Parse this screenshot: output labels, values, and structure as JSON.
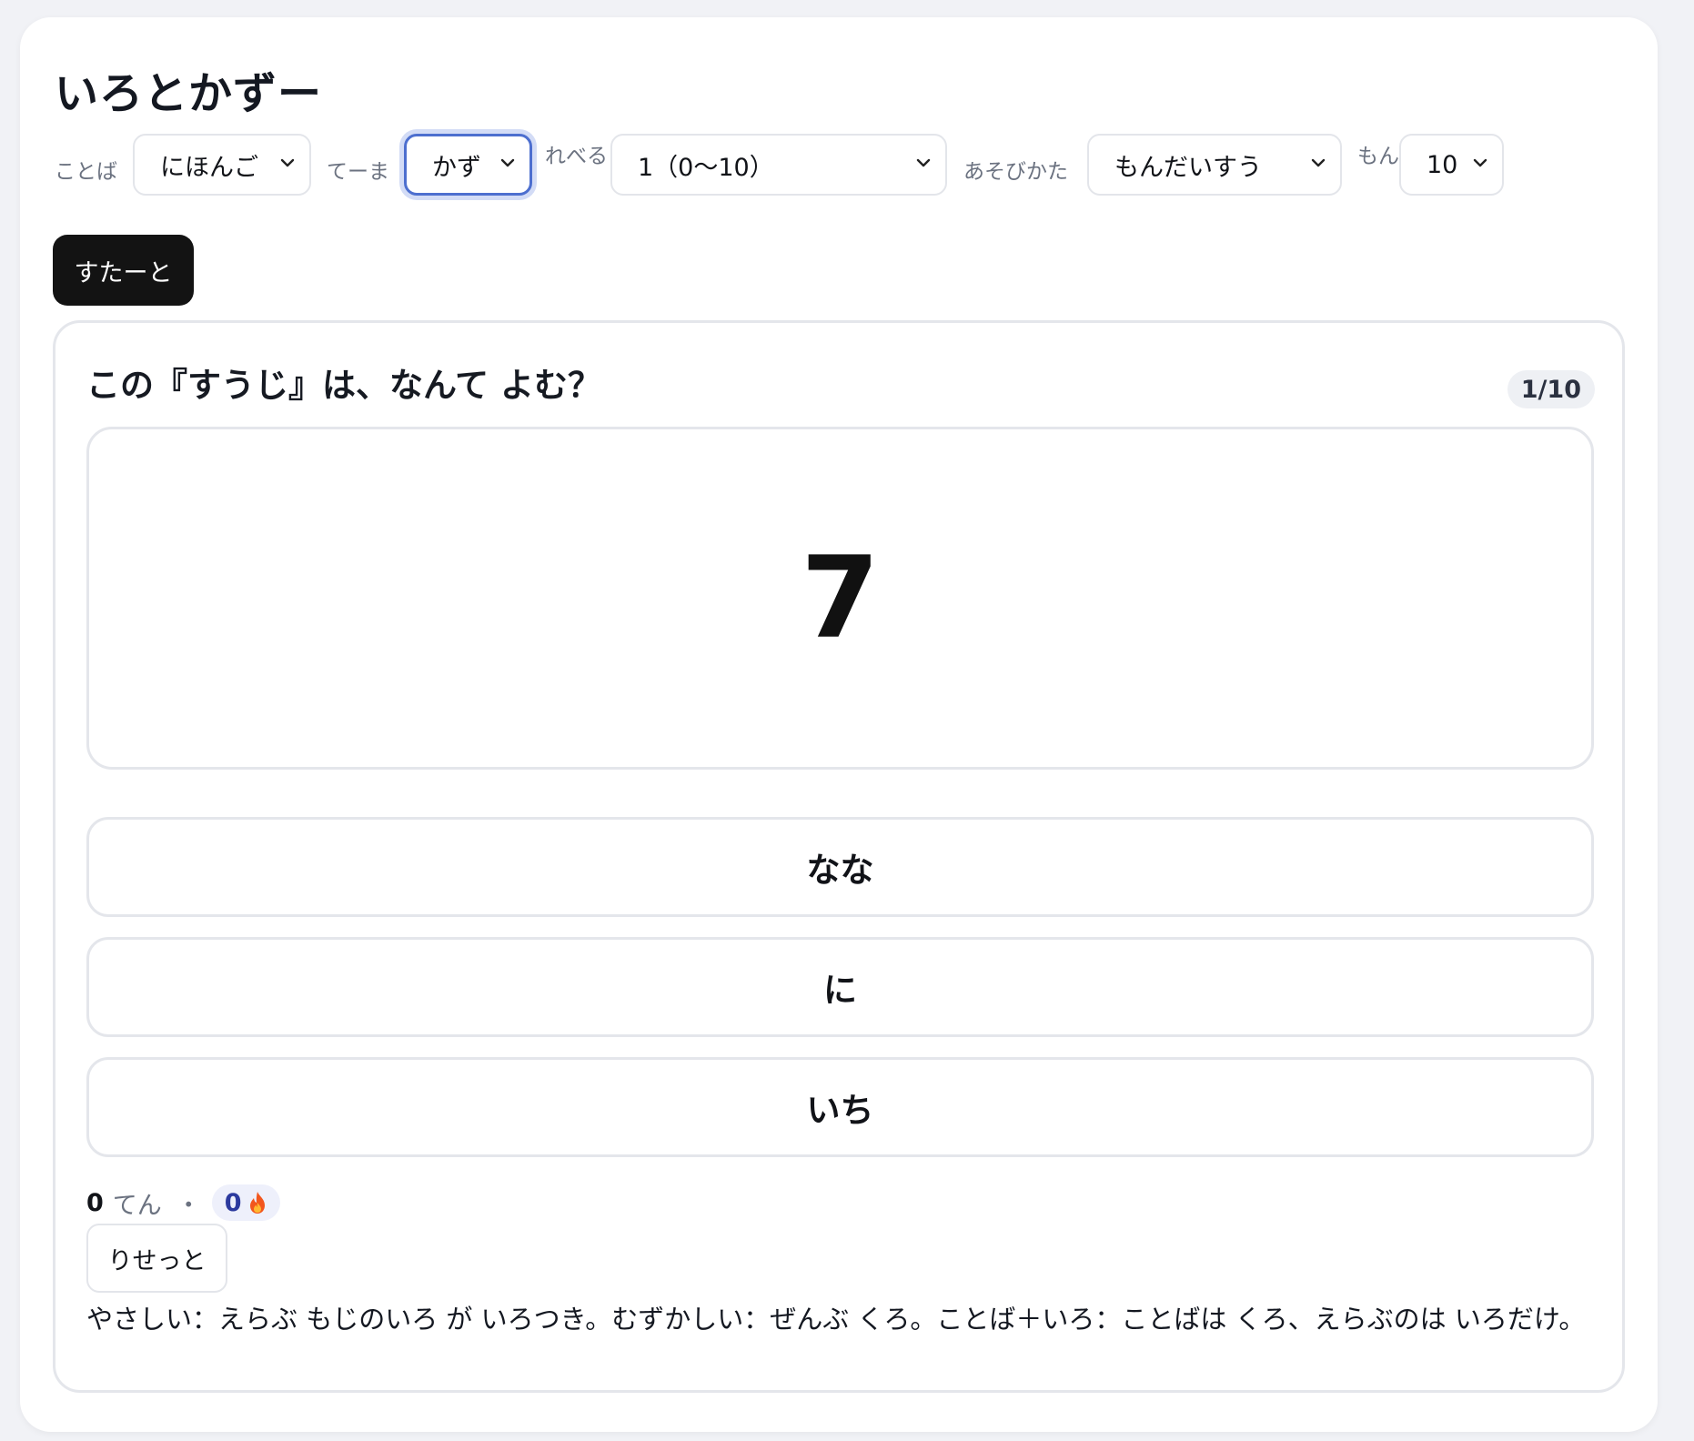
{
  "app": {
    "title": "いろとかずー"
  },
  "settings": {
    "language": {
      "label": "ことば",
      "value": "にほんご"
    },
    "theme": {
      "label": "てーま",
      "value": "かず"
    },
    "level": {
      "label": "れべる",
      "value": "1（0〜10）"
    },
    "mode": {
      "label": "あそびかた",
      "value": "もんだいすう"
    },
    "count": {
      "label": "もん",
      "value": "10"
    }
  },
  "controls": {
    "start_label": "すたーと",
    "reset_label": "りせっと"
  },
  "quiz": {
    "question": "この『すうじ』は、なんて よむ？",
    "progress": "1/10",
    "display_value": "7",
    "choices": [
      {
        "label": "なな"
      },
      {
        "label": "に"
      },
      {
        "label": "いち"
      }
    ]
  },
  "score": {
    "points": "0",
    "points_unit": "てん",
    "separator": "・",
    "streak": "0",
    "streak_icon": "flame-icon"
  },
  "help_text": "やさしい：えらぶ もじのいろ が いろつき。むずかしい：ぜんぶ くろ。ことば＋いろ：ことばは くろ、えらぶのは いろだけ。"
}
